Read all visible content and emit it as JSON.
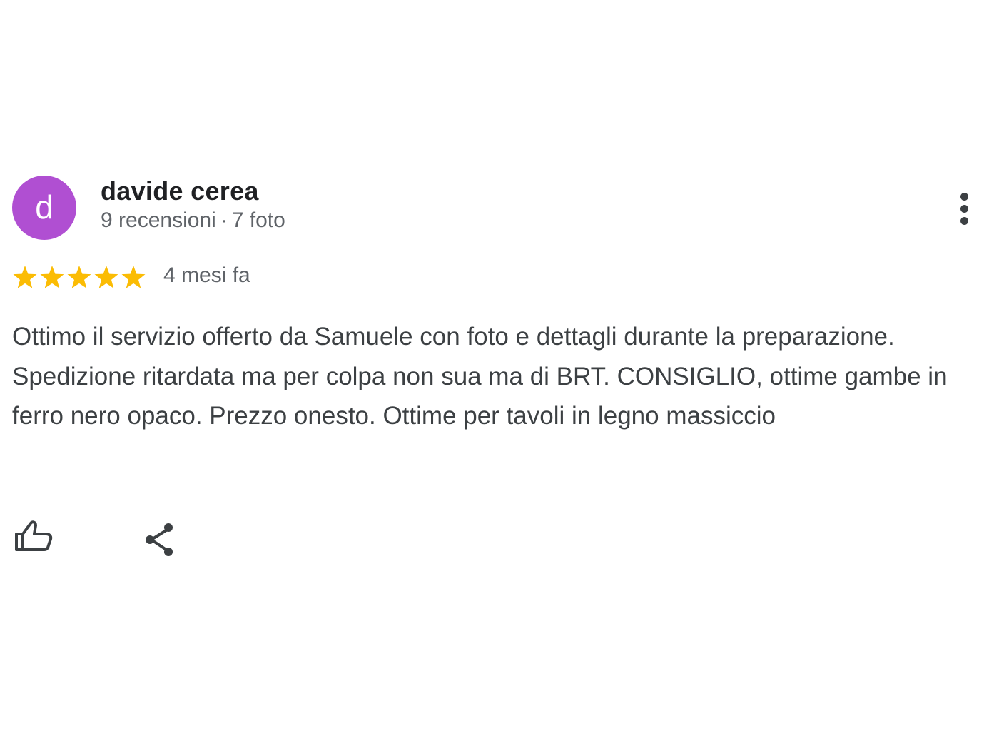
{
  "review": {
    "avatar_letter": "d",
    "author_name": "davide cerea",
    "reviews_count": "9 recensioni",
    "meta_separator": "·",
    "photos_count": "7 foto",
    "rating": 5,
    "rating_max": 5,
    "time_ago": "4 mesi fa",
    "text": "Ottimo il servizio offerto da Samuele con foto e dettagli durante la preparazione. Spedizione ritardata ma per colpa non sua ma di BRT. CONSIGLIO, ottime gambe in ferro nero opaco. Prezzo onesto. Ottime per tavoli in legno massiccio"
  },
  "icons": {
    "more": "more-vert-icon",
    "star": "star-icon",
    "like": "thumb-up-icon",
    "share": "share-icon"
  },
  "colors": {
    "avatar_bg": "#b04fd2",
    "star": "#fbbc04",
    "icon": "#3c4043",
    "text": "#3c4043",
    "secondary_text": "#5f6368"
  }
}
